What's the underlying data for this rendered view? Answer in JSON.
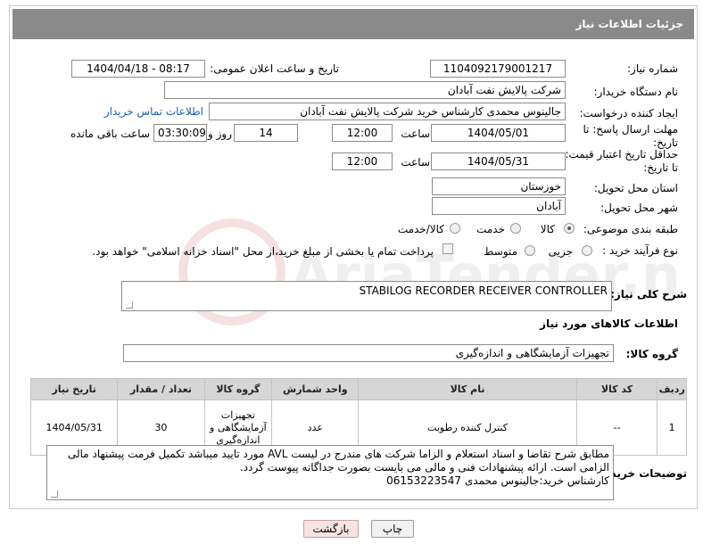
{
  "header": {
    "title": "جزئیات اطلاعات نیاز"
  },
  "fields": {
    "need_number_label": "شماره نیاز:",
    "need_number": "1104092179001217",
    "announce_label": "تاریخ و ساعت اعلان عمومی:",
    "announce_value": "1404/04/18 - 08:17",
    "buyer_org_label": "نام دستگاه خریدار:",
    "buyer_org": "شرکت پالایش نفت آبادان",
    "creator_label": "ایجاد کننده درخواست:",
    "creator": "جالینوس محمدی کارشناس خرید  شرکت پالایش نفت آبادان",
    "contact_link": "اطلاعات تماس خریدار",
    "deadline_label": "مهلت ارسال پاسخ: تا تاریخ:",
    "deadline_date": "1404/05/01",
    "time_label": "ساعت",
    "deadline_time": "12:00",
    "days_value": "14",
    "days_label": "روز و",
    "remaining_time": "03:30:09",
    "remaining_label": "ساعت باقی مانده",
    "validity_label": "حداقل تاریخ اعتبار قیمت: تا تاریخ:",
    "validity_date": "1404/05/31",
    "validity_time": "12:00",
    "province_label": "استان محل تحویل:",
    "province": "خوزستان",
    "city_label": "شهر محل تحویل:",
    "city": "آبادان",
    "category_label": "طبقه بندی موضوعی:",
    "category_options": [
      "کالا",
      "خدمت",
      "کالا/خدمت"
    ],
    "process_label": "نوع فرآیند خرید :",
    "process_options": [
      "جزیی",
      "متوسط"
    ],
    "payment_note": "پرداخت تمام یا بخشی از مبلغ خرید،از محل \"اسناد خزانه اسلامی\" خواهد بود.",
    "summary_label": "شرح کلی نیاز:",
    "summary": "STABILOG RECORDER RECEIVER CONTROLLER",
    "items_info_label": "اطلاعات کالاهای مورد نیاز",
    "goods_group_label": "گروه کالا:",
    "goods_group": "تجهیزات آزمایشگاهی و اندازه‌گیری"
  },
  "table": {
    "headers": [
      "ردیف",
      "کد کالا",
      "نام کالا",
      "واحد شمارش",
      "گروه کالا",
      "تعداد / مقدار",
      "تاریخ نیاز"
    ],
    "rows": [
      {
        "row": "1",
        "code": "--",
        "name": "کنترل کننده رطوبت",
        "unit": "عدد",
        "group": "تجهیزات آزمایشگاهی و اندازه‌گیری",
        "qty": "30",
        "date": "1404/05/31"
      }
    ]
  },
  "notes": {
    "label": "توضیحات خریدار:",
    "line1": "مطابق شرح  تقاضا و اسناد استعلام و الزاما شرکت های مندرج  در لیست AVL مورد تایید میباشد تکمیل فرمت پیشنهاد مالی",
    "line2": "الزامی است. ارائه پیشنهادات فنی و مالی می بایست بصورت جداگانه پیوست گردد.",
    "line3": "کارشناس خرید:جالینوس محمدی 06153223547"
  },
  "buttons": {
    "print": "چاپ",
    "back": "بازگشت"
  },
  "watermark": {
    "text": "AriaTender.neT"
  }
}
